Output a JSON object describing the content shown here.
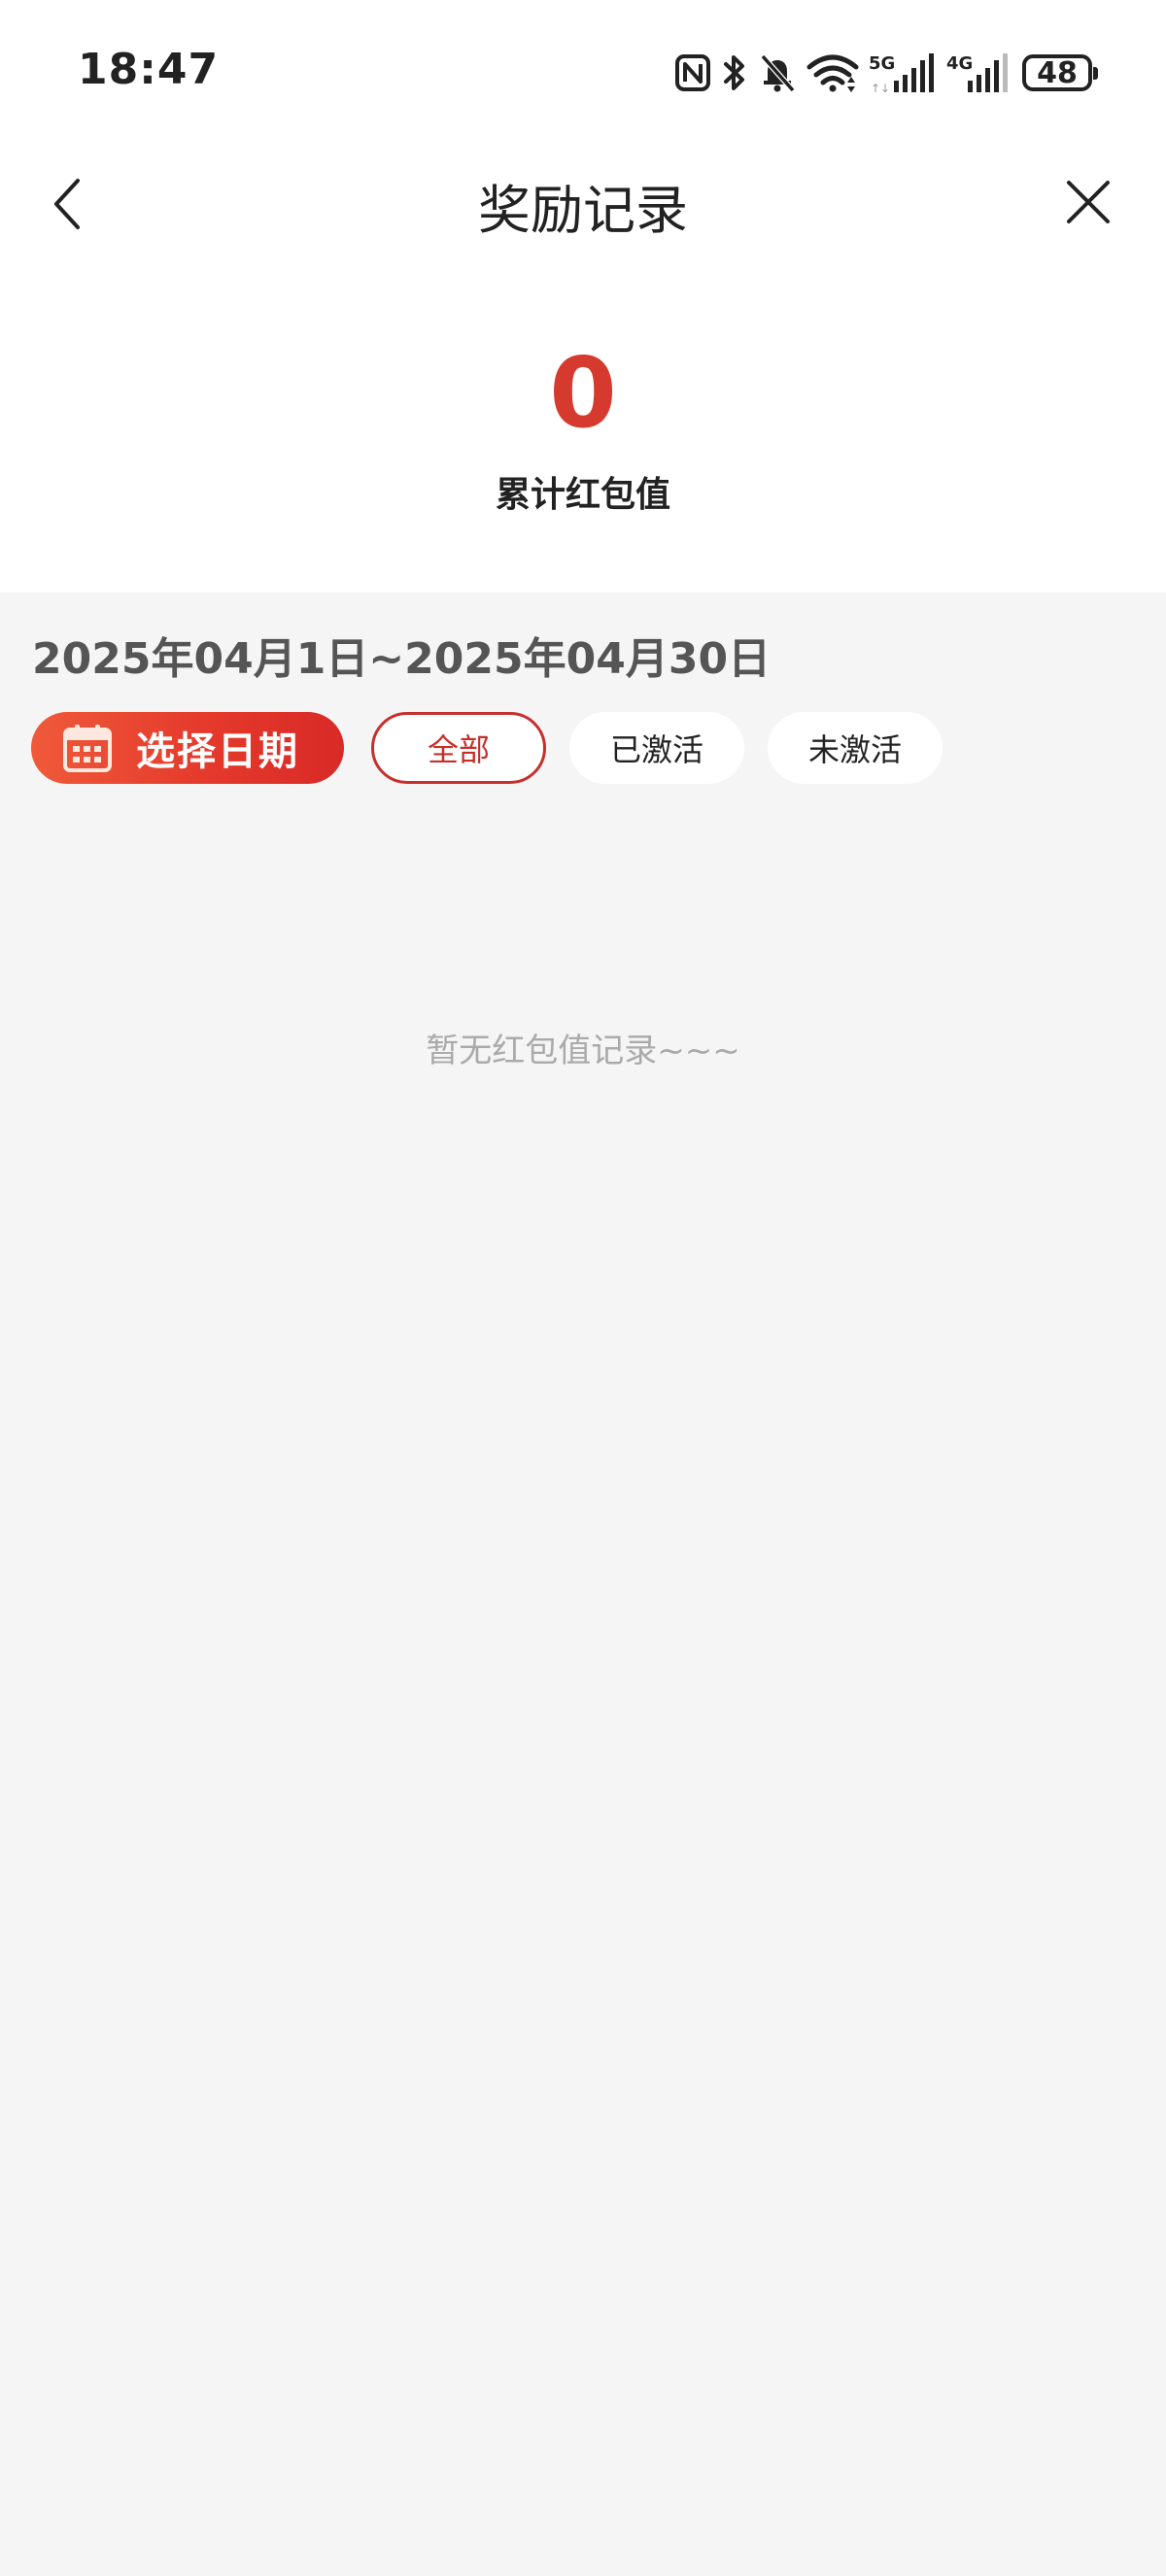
{
  "status_bar": {
    "time": "18:47",
    "network_5g": "5G",
    "network_4g": "4G",
    "battery": "48",
    "icons": [
      "nfc-icon",
      "bluetooth-icon",
      "mute-bell-icon",
      "wifi-icon",
      "signal-5g-icon",
      "signal-4g-icon",
      "battery-icon"
    ]
  },
  "header": {
    "title": "奖励记录",
    "back_icon": "chevron-left-icon",
    "close_icon": "close-icon"
  },
  "summary": {
    "total_value": "0",
    "total_label": "累计红包值"
  },
  "filter": {
    "date_range": "2025年04月1日~2025年04月30日",
    "pick_date_label": "选择日期",
    "pick_date_icon": "calendar-icon",
    "chips": [
      {
        "label": "全部",
        "active": true
      },
      {
        "label": "已激活",
        "active": false
      },
      {
        "label": "未激活",
        "active": false
      }
    ]
  },
  "list": {
    "empty_text": "暂无红包值记录~~~"
  },
  "colors": {
    "accent": "#d63a2f",
    "chip_active": "#c6302c",
    "background": "#f5f5f5"
  }
}
